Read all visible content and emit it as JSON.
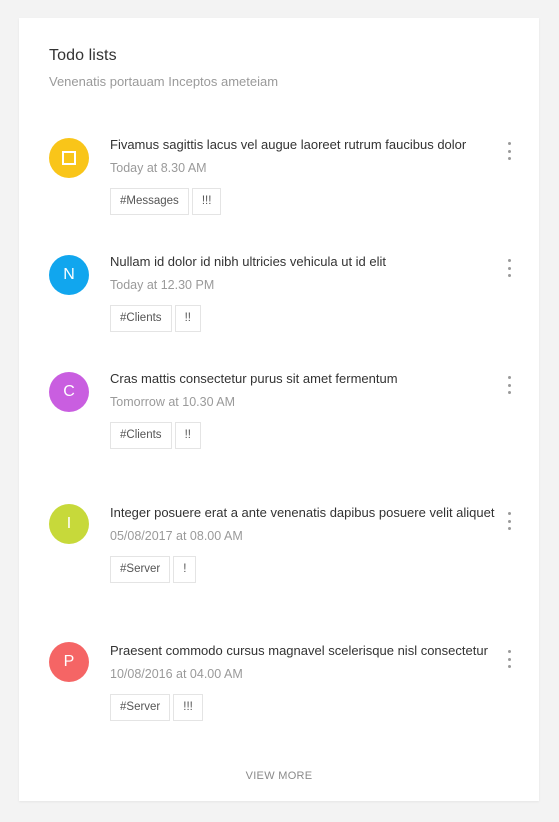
{
  "card": {
    "title": "Todo lists",
    "subtitle": "Venenatis portauam Inceptos ameteiam"
  },
  "todos": [
    {
      "avatar_letter": "",
      "avatar_icon": "square-icon",
      "avatar_color": "#f9c519",
      "text": "Fivamus sagittis lacus vel augue laoreet rutrum faucibus dolor",
      "time": "Today at 8.30 AM",
      "tags": [
        "#Messages",
        "!!!"
      ]
    },
    {
      "avatar_letter": "N",
      "avatar_color": "#11a6ee",
      "text": "Nullam id dolor id nibh ultricies vehicula ut id elit",
      "time": "Today at 12.30 PM",
      "tags": [
        "#Clients",
        "!!"
      ]
    },
    {
      "avatar_letter": "C",
      "avatar_color": "#c95ee0",
      "text": "Cras mattis consectetur purus sit amet fermentum",
      "time": "Tomorrow at 10.30 AM",
      "tags": [
        "#Clients",
        "!!"
      ]
    },
    {
      "avatar_letter": "I",
      "avatar_color": "#c7d93a",
      "text": "Integer posuere erat a ante venenatis dapibus posuere velit aliquet",
      "time": "05/08/2017 at 08.00 AM",
      "tags": [
        "#Server",
        "!"
      ]
    },
    {
      "avatar_letter": "P",
      "avatar_color": "#f56565",
      "text": "Praesent commodo cursus magnavel scelerisque nisl consectetur",
      "time": "10/08/2016 at 04.00 AM",
      "tags": [
        "#Server",
        "!!!"
      ]
    }
  ],
  "footer": {
    "view_more_label": "VIEW MORE"
  },
  "icons": {
    "more": "more-vertical-icon"
  }
}
